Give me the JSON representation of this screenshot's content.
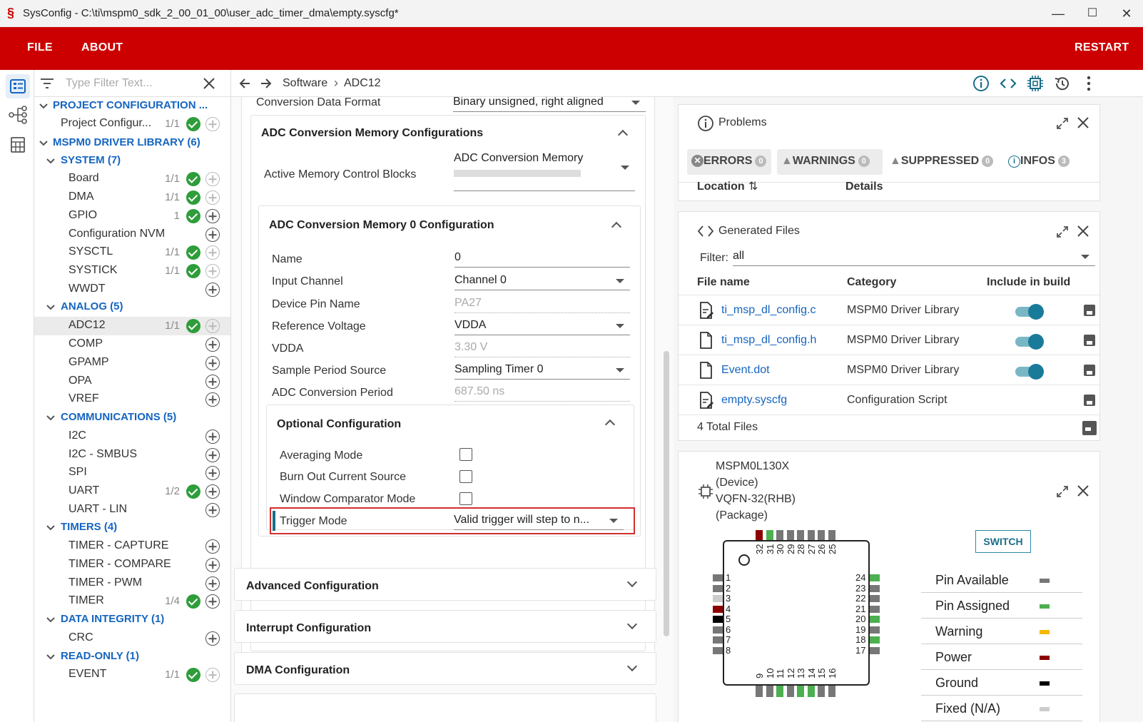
{
  "window": {
    "title": "SysConfig - C:\\ti\\mspm0_sdk_2_00_01_00\\user_adc_timer_dma\\empty.syscfg*",
    "min": "—",
    "max": "☐",
    "close": "✕"
  },
  "menu": {
    "file": "FILE",
    "about": "ABOUT",
    "restart": "RESTART"
  },
  "filter": {
    "placeholder": "Type Filter Text..."
  },
  "tree": {
    "project_config": "PROJECT CONFIGURATION ...",
    "project_config_item": "Project Configur...",
    "project_config_count": "1/1",
    "driver_lib": "MSPM0 DRIVER LIBRARY (6)",
    "system": "SYSTEM (7)",
    "board": "Board",
    "board_count": "1/1",
    "dma": "DMA",
    "dma_count": "1/1",
    "gpio": "GPIO",
    "gpio_count": "1",
    "config_nvm": "Configuration NVM",
    "sysctl": "SYSCTL",
    "sysctl_count": "1/1",
    "systick": "SYSTICK",
    "systick_count": "1/1",
    "wwdt": "WWDT",
    "analog": "ANALOG (5)",
    "adc12": "ADC12",
    "adc12_count": "1/1",
    "comp": "COMP",
    "gpamp": "GPAMP",
    "opa": "OPA",
    "vref": "VREF",
    "communications": "COMMUNICATIONS (5)",
    "i2c": "I2C",
    "i2c_smbus": "I2C - SMBUS",
    "spi": "SPI",
    "uart": "UART",
    "uart_count": "1/2",
    "uart_lin": "UART - LIN",
    "timers": "TIMERS (4)",
    "timer_capture": "TIMER - CAPTURE",
    "timer_compare": "TIMER - COMPARE",
    "timer_pwm": "TIMER - PWM",
    "timer": "TIMER",
    "timer_count": "1/4",
    "data_integrity": "DATA INTEGRITY (1)",
    "crc": "CRC",
    "read_only": "READ-ONLY (1)",
    "event": "EVENT",
    "event_count": "1/1"
  },
  "breadcrumb": {
    "software": "Software",
    "sep": "›",
    "adc12": "ADC12"
  },
  "config": {
    "conv_data_format_label": "Conversion Data Format",
    "conv_data_format_value": "Binary unsigned, right aligned",
    "mem_configs_title": "ADC Conversion Memory Configurations",
    "active_blocks_label": "Active Memory Control Blocks",
    "active_blocks_value": "ADC Conversion Memory",
    "mem0_title": "ADC Conversion Memory 0 Configuration",
    "name_label": "Name",
    "name_value": "0",
    "input_channel_label": "Input Channel",
    "input_channel_value": "Channel 0",
    "device_pin_label": "Device Pin Name",
    "device_pin_value": "PA27",
    "ref_voltage_label": "Reference Voltage",
    "ref_voltage_value": "VDDA",
    "vdda_label": "VDDA",
    "vdda_value": "3.30 V",
    "sample_src_label": "Sample Period Source",
    "sample_src_value": "Sampling Timer 0",
    "conv_period_label": "ADC Conversion Period",
    "conv_period_value": "687.50 ns",
    "optional_title": "Optional Configuration",
    "averaging_label": "Averaging Mode",
    "burnout_label": "Burn Out Current Source",
    "window_label": "Window Comparator Mode",
    "trigger_label": "Trigger Mode",
    "trigger_value": "Valid trigger will step to n...",
    "advanced_title": "Advanced Configuration",
    "interrupt_title": "Interrupt Configuration",
    "dma_title": "DMA Configuration"
  },
  "problems": {
    "title": "Problems",
    "errors": "ERRORS",
    "errors_count": "0",
    "warnings": "WARNINGS",
    "warnings_count": "0",
    "suppressed": "SUPPRESSED",
    "suppressed_count": "0",
    "infos": "INFOS",
    "infos_count": "3",
    "col_location": "Location",
    "col_details": "Details"
  },
  "generated": {
    "title": "Generated Files",
    "filter_label": "Filter:",
    "filter_value": "all",
    "col_file": "File name",
    "col_category": "Category",
    "col_include": "Include in build",
    "files": [
      {
        "name": "ti_msp_dl_config.c",
        "category": "MSPM0 Driver Library"
      },
      {
        "name": "ti_msp_dl_config.h",
        "category": "MSPM0 Driver Library"
      },
      {
        "name": "Event.dot",
        "category": "MSPM0 Driver Library"
      },
      {
        "name": "empty.syscfg",
        "category": "Configuration Script"
      }
    ],
    "total": "4 Total Files"
  },
  "device": {
    "name": "MSPM0L130X",
    "device_tag": "(Device)",
    "package": "VQFN-32(RHB)",
    "package_tag": "(Package)",
    "switch": "SWITCH",
    "top_pins": [
      "32",
      "31",
      "30",
      "29",
      "28",
      "27",
      "26",
      "25"
    ],
    "left_pins": [
      "1",
      "2",
      "3",
      "4",
      "5",
      "6",
      "7",
      "8"
    ],
    "right_pins": [
      "24",
      "23",
      "22",
      "21",
      "20",
      "19",
      "18",
      "17"
    ],
    "bottom_pins": [
      "9",
      "10",
      "11",
      "12",
      "13",
      "14",
      "15",
      "16"
    ],
    "legend": [
      {
        "label": "Pin Available",
        "color": "#777777"
      },
      {
        "label": "Pin Assigned",
        "color": "#4caf50"
      },
      {
        "label": "Warning",
        "color": "#f5b800"
      },
      {
        "label": "Power",
        "color": "#8b0000"
      },
      {
        "label": "Ground",
        "color": "#000000"
      },
      {
        "label": "Fixed (N/A)",
        "color": "#cccccc"
      }
    ]
  }
}
